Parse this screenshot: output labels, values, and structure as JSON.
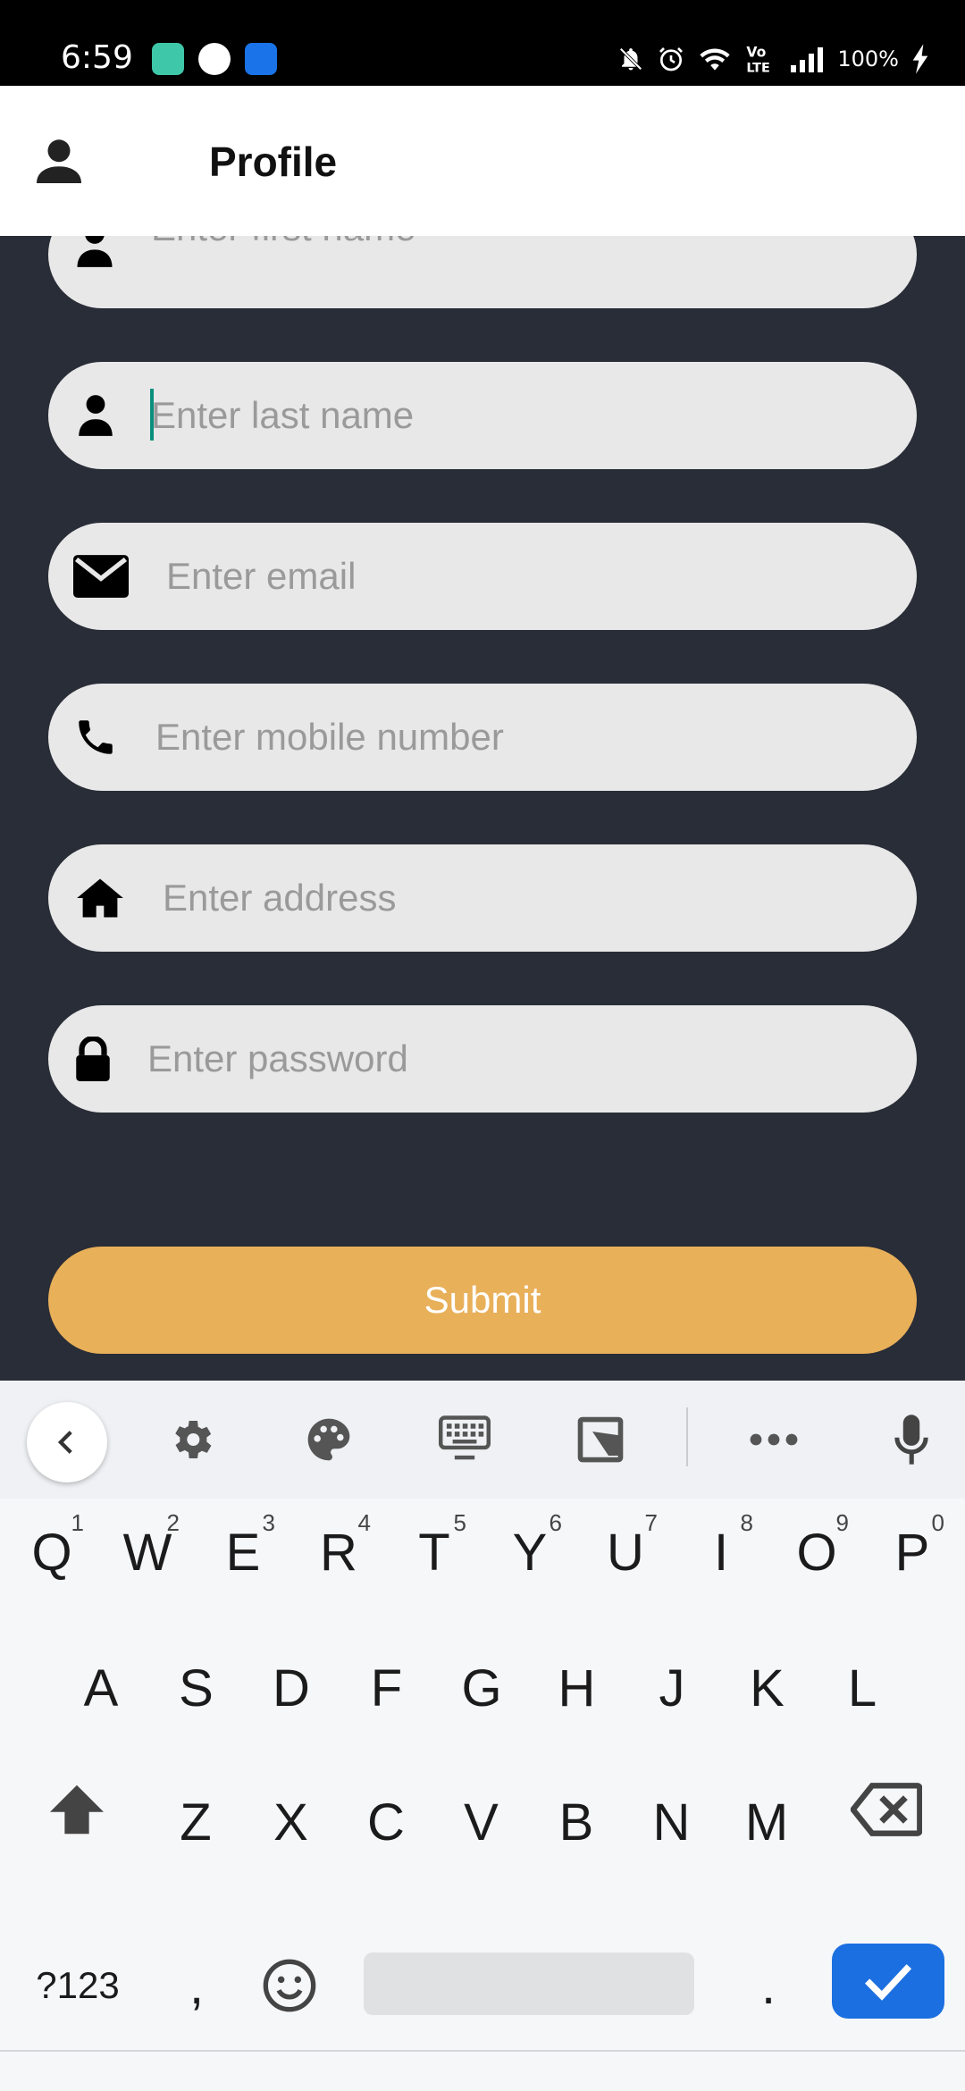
{
  "status_bar": {
    "time": "6:59",
    "battery": "100%",
    "icons": [
      "app-icon-green",
      "phone-call-icon",
      "usb-icon",
      "notifications-off-icon",
      "alarm-icon",
      "wifi-icon",
      "volte-icon",
      "signal-icon",
      "charging-icon"
    ]
  },
  "app_bar": {
    "title": "Profile",
    "icon": "person-icon"
  },
  "form": {
    "fields": [
      {
        "name": "first-name",
        "icon": "person-icon",
        "placeholder": "Enter first name",
        "value": ""
      },
      {
        "name": "last-name",
        "icon": "person-icon",
        "placeholder": "Enter last name",
        "value": "",
        "focused": true
      },
      {
        "name": "email",
        "icon": "envelope-icon",
        "placeholder": "Enter email",
        "value": ""
      },
      {
        "name": "mobile",
        "icon": "phone-icon",
        "placeholder": "Enter mobile number",
        "value": ""
      },
      {
        "name": "address",
        "icon": "home-icon",
        "placeholder": "Enter address",
        "value": ""
      },
      {
        "name": "password",
        "icon": "lock-icon",
        "placeholder": "Enter password",
        "value": ""
      }
    ],
    "submit_label": "Submit"
  },
  "keyboard": {
    "toolbar": [
      "back-icon",
      "settings-icon",
      "palette-icon",
      "keyboard-icon",
      "resize-icon",
      "more-icon",
      "mic-icon"
    ],
    "row1": [
      {
        "k": "Q",
        "h": "1"
      },
      {
        "k": "W",
        "h": "2"
      },
      {
        "k": "E",
        "h": "3"
      },
      {
        "k": "R",
        "h": "4"
      },
      {
        "k": "T",
        "h": "5"
      },
      {
        "k": "Y",
        "h": "6"
      },
      {
        "k": "U",
        "h": "7"
      },
      {
        "k": "I",
        "h": "8"
      },
      {
        "k": "O",
        "h": "9"
      },
      {
        "k": "P",
        "h": "0"
      }
    ],
    "row2": [
      "A",
      "S",
      "D",
      "F",
      "G",
      "H",
      "J",
      "K",
      "L"
    ],
    "row3": [
      "Z",
      "X",
      "C",
      "V",
      "B",
      "N",
      "M"
    ],
    "symbols_label": "?123",
    "comma": ",",
    "period": "."
  },
  "colors": {
    "background": "#292d37",
    "field": "#e8e8e8",
    "submit": "#e9b05a",
    "enter_key": "#1b6fe0",
    "caret": "#0a8f7e"
  }
}
